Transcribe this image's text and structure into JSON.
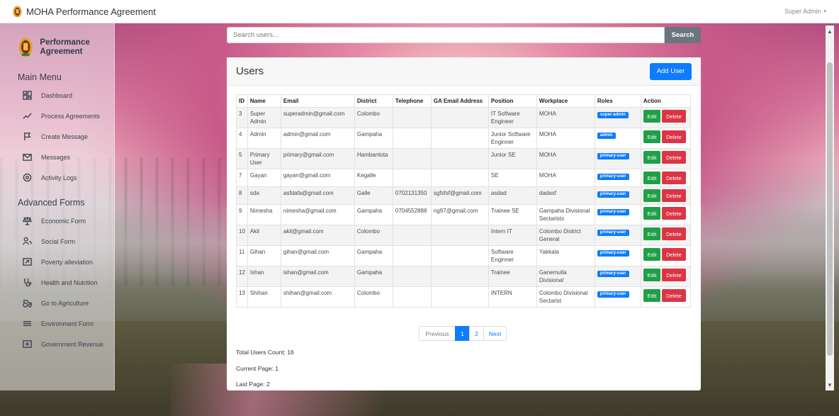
{
  "app": {
    "title": "MOHA Performance Agreement",
    "user_menu": "Super Admin"
  },
  "sidebar": {
    "brand": "Performance Agreement",
    "main_heading": "Main Menu",
    "main_items": [
      {
        "label": "Dashboard",
        "icon": "dashboard-icon"
      },
      {
        "label": "Process Agreements",
        "icon": "trend-line-icon"
      },
      {
        "label": "Create Message",
        "icon": "flag-icon"
      },
      {
        "label": "Messages",
        "icon": "envelope-icon"
      },
      {
        "label": "Activity Logs",
        "icon": "activity-icon"
      }
    ],
    "advanced_heading": "Advanced Forms",
    "advanced_items": [
      {
        "label": "Economic Form",
        "icon": "scale-icon"
      },
      {
        "label": "Social Form",
        "icon": "users-icon"
      },
      {
        "label": "Poverty alleviation",
        "icon": "arrow-box-icon"
      },
      {
        "label": "Health and Nutrition",
        "icon": "health-icon"
      },
      {
        "label": "Go to Agriculture",
        "icon": "tractor-icon"
      },
      {
        "label": "Environment Form",
        "icon": "environment-icon"
      },
      {
        "label": "Government Revenue",
        "icon": "revenue-icon"
      }
    ]
  },
  "search": {
    "placeholder": "Search users...",
    "button": "Search"
  },
  "users": {
    "title": "Users",
    "add_button": "Add User",
    "columns": [
      "ID",
      "Name",
      "Email",
      "District",
      "Telephone",
      "GA Email Address",
      "Position",
      "Workplace",
      "Roles",
      "Action"
    ],
    "edit_label": "Edit",
    "delete_label": "Delete",
    "rows": [
      {
        "id": "3",
        "name": "Super Admin",
        "email": "superadmin@gmail.com",
        "district": "Colombo",
        "telephone": "",
        "ga_email": "",
        "position": "IT Software Engineer",
        "workplace": "MOHA",
        "role": "super-admin"
      },
      {
        "id": "4",
        "name": "Admin",
        "email": "admin@gmail.com",
        "district": "Gampaha",
        "telephone": "",
        "ga_email": "",
        "position": "Junior Software Enginner",
        "workplace": "MOHA",
        "role": "admin"
      },
      {
        "id": "5",
        "name": "Primary User",
        "email": "primary@gmail.com",
        "district": "Hambantota",
        "telephone": "",
        "ga_email": "",
        "position": "Junior SE",
        "workplace": "MOHA",
        "role": "primary-user"
      },
      {
        "id": "7",
        "name": "Gayan",
        "email": "gayan@gmail.com",
        "district": "Kegalle",
        "telephone": "",
        "ga_email": "",
        "position": "SE",
        "workplace": "MOHA",
        "role": "primary-user"
      },
      {
        "id": "8",
        "name": "sda",
        "email": "asfdafa@gmail.com",
        "district": "Galle",
        "telephone": "0702131350",
        "ga_email": "sgfsfsf@gmail.com",
        "position": "asdad",
        "workplace": "dadasf",
        "role": "primary-user"
      },
      {
        "id": "9",
        "name": "Nimesha",
        "email": "nimesha@gmail.com",
        "district": "Gampaha",
        "telephone": "0704552888",
        "ga_email": "ng97@gmail.com",
        "position": "Trainee SE",
        "workplace": "Gampaha Divisional Sectarists",
        "role": "primary-user"
      },
      {
        "id": "10",
        "name": "Akil",
        "email": "akil@gmail.com",
        "district": "Colombo",
        "telephone": "",
        "ga_email": "",
        "position": "Intern IT",
        "workplace": "Colombo District General",
        "role": "primary-user"
      },
      {
        "id": "11",
        "name": "Gihan",
        "email": "gihan@gmail.com",
        "district": "Gampaha",
        "telephone": "",
        "ga_email": "",
        "position": "Software Enginner",
        "workplace": "Yakkala",
        "role": "primary-user"
      },
      {
        "id": "12",
        "name": "Ishan",
        "email": "ishan@gmail.com",
        "district": "Gampaha",
        "telephone": "",
        "ga_email": "",
        "position": "Trainee",
        "workplace": "Ganemulla Divisional",
        "role": "primary-user"
      },
      {
        "id": "13",
        "name": "Shihan",
        "email": "shihan@gmail.com",
        "district": "Colombo",
        "telephone": "",
        "ga_email": "",
        "position": "INTERN",
        "workplace": "Colombo Divisional Sectarist",
        "role": "primary-user"
      }
    ]
  },
  "pagination": {
    "prev": "Previous",
    "pages": [
      "1",
      "2"
    ],
    "active_page": "1",
    "next": "Next"
  },
  "stats": {
    "total": "Total Users Count: 16",
    "current": "Current Page: 1",
    "last": "Last Page: 2"
  },
  "colors": {
    "primary": "#0d7cff",
    "edit": "#1fa046",
    "delete": "#dc3545",
    "search_button": "#6c757d"
  }
}
